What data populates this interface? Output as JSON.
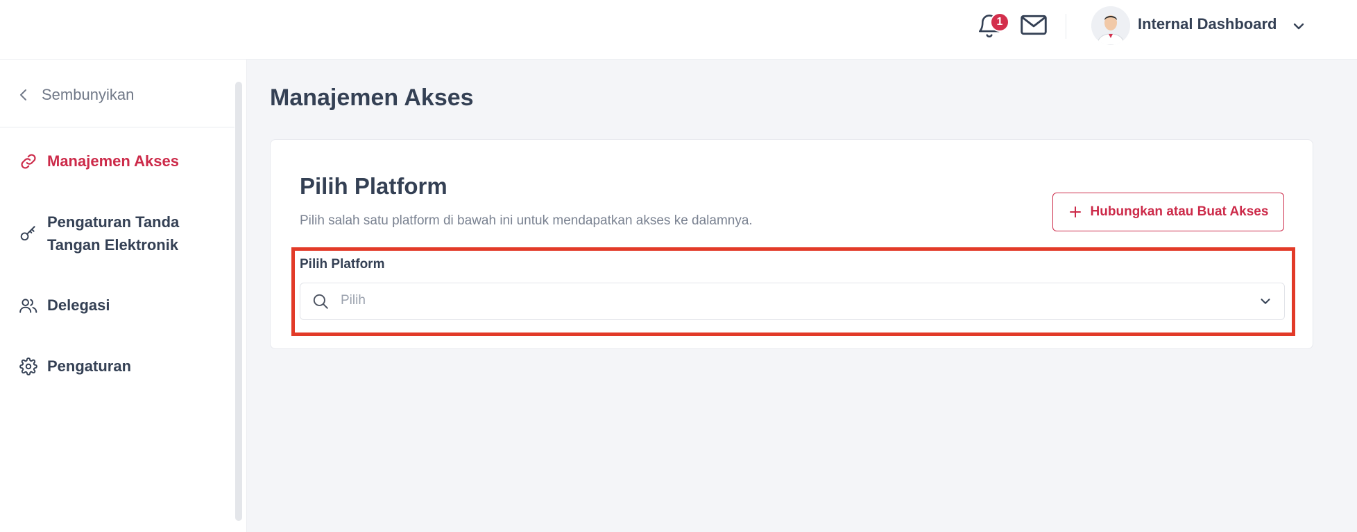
{
  "header": {
    "notification_count": "1",
    "user_name": "Internal Dashboard",
    "icons": [
      "bell-icon",
      "mail-icon",
      "avatar",
      "chevron-down-icon"
    ]
  },
  "sidebar": {
    "hide_label": "Sembunyikan",
    "items": [
      {
        "label": "Manajemen Akses",
        "icon": "link-icon",
        "active": true
      },
      {
        "label_lines": [
          "Pengaturan Tanda",
          "Tangan Elektronik"
        ],
        "icon": "key-icon",
        "active": false
      },
      {
        "label": "Delegasi",
        "icon": "users-icon",
        "active": false
      },
      {
        "label": "Pengaturan",
        "icon": "gear-icon",
        "active": false
      }
    ]
  },
  "main": {
    "page_title": "Manajemen Akses",
    "card": {
      "title": "Pilih Platform",
      "description": "Pilih salah satu platform di bawah ini untuk mendapatkan akses ke dalamnya.",
      "connect_button_label": "Hubungkan atau Buat Akses",
      "field_label": "Pilih Platform",
      "select_placeholder": "Pilih"
    }
  },
  "colors": {
    "accent": "#cc2a49",
    "highlight": "#e23a28",
    "text": "#344054",
    "muted": "#7a8291",
    "background": "#f4f5f8"
  }
}
